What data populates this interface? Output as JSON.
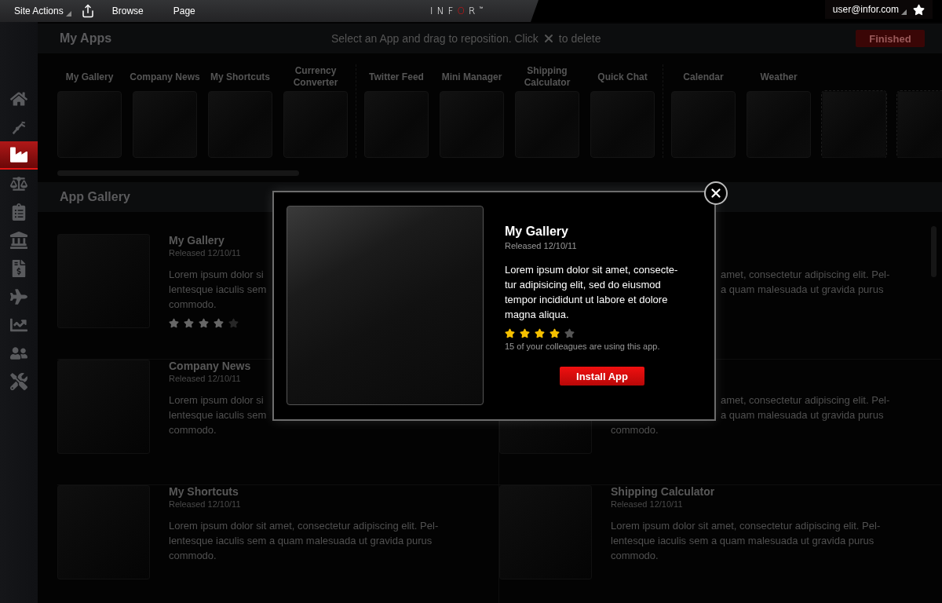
{
  "top_bar": {
    "site_actions": "Site Actions",
    "browse": "Browse",
    "page": "Page",
    "logo": [
      {
        "text": "INF",
        "accent": false
      },
      {
        "text": "O",
        "accent": true
      },
      {
        "text": "R",
        "accent": false
      }
    ],
    "logo_mark": "™",
    "user": "user@infor.com"
  },
  "sidebar": {
    "items": [
      {
        "kind": "home",
        "selected": false
      },
      {
        "kind": "robot_arm",
        "selected": false
      },
      {
        "kind": "factory",
        "selected": true
      },
      {
        "kind": "scale",
        "selected": false
      },
      {
        "kind": "clipboard",
        "selected": false
      },
      {
        "kind": "bank",
        "selected": false
      },
      {
        "kind": "invoice",
        "selected": false
      },
      {
        "kind": "plane",
        "selected": false
      },
      {
        "kind": "chart",
        "selected": false
      },
      {
        "kind": "people",
        "selected": false
      },
      {
        "kind": "tools",
        "selected": false
      }
    ]
  },
  "my_apps": {
    "title": "My Apps",
    "hint_before": "Select an App and drag to reposition. Click",
    "hint_after": "to delete",
    "finished": "Finished",
    "groups": [
      [
        {
          "kind": "app",
          "label": "My Gallery"
        },
        {
          "kind": "app",
          "label": "Company News"
        },
        {
          "kind": "app",
          "label": "My Shortcuts"
        },
        {
          "kind": "app",
          "label": "Currency Converter"
        }
      ],
      [
        {
          "kind": "app",
          "label": "Twitter Feed"
        },
        {
          "kind": "app",
          "label": "Mini Manager"
        },
        {
          "kind": "app",
          "label": "Shipping Calculator"
        },
        {
          "kind": "app",
          "label": "Quick Chat"
        }
      ],
      [
        {
          "kind": "app",
          "label": "Calendar"
        },
        {
          "kind": "app",
          "label": "Weather"
        },
        {
          "kind": "empty"
        },
        {
          "kind": "empty"
        }
      ]
    ]
  },
  "gallery": {
    "title": "App Gallery",
    "items": [
      {
        "kind": "card",
        "title": "My Gallery",
        "released": "Released 12/10/11",
        "lines": [
          {
            "text": "Lorem ipsum dolor si",
            "cut_left": false
          },
          {
            "text": "lentesque iaculis sem",
            "cut_left": false
          },
          {
            "text": "commodo.",
            "cut_left": false
          }
        ],
        "stars": 4
      },
      {
        "kind": "text_only",
        "lines": [
          {
            "text": "amet, consectetur adipiscing elit. Pel-",
            "cut_left": true
          },
          {
            "text": "a quam malesuada ut gravida purus",
            "cut_left": true
          }
        ]
      },
      {
        "kind": "card",
        "title": "Company News",
        "released": "Released 12/10/11",
        "lines": [
          {
            "text": "Lorem ipsum dolor si",
            "cut_left": false
          },
          {
            "text": "lentesque iaculis sem",
            "cut_left": false
          },
          {
            "text": "commodo.",
            "cut_left": false
          }
        ]
      },
      {
        "kind": "card",
        "lines": [
          {
            "text": "amet, consectetur adipiscing elit. Pel-",
            "cut_left": true
          },
          {
            "text": "a quam malesuada ut gravida purus",
            "cut_left": true
          },
          {
            "text": "commodo.",
            "cut_left": false
          }
        ]
      },
      {
        "kind": "card",
        "title": "My Shortcuts",
        "released": "Released 12/10/11",
        "description": [
          "Lorem ipsum dolor sit amet, consectetur adipiscing elit. Pel-",
          "lentesque iaculis sem a quam malesuada ut gravida purus",
          "commodo."
        ]
      },
      {
        "kind": "card",
        "title": "Shipping Calculator",
        "released": "Released 12/10/11",
        "description": [
          "Lorem ipsum dolor sit amet, consectetur adipiscing elit. Pel-",
          "lentesque iaculis sem a quam malesuada ut gravida purus",
          "commodo."
        ]
      }
    ]
  },
  "modal": {
    "title": "My Gallery",
    "released": "Released 12/10/11",
    "description": [
      "Lorem ipsum dolor sit amet, consecte-",
      "tur adipisicing elit, sed do eiusmod",
      "tempor incididunt ut labore et dolore",
      "magna aliqua."
    ],
    "stars": 4,
    "usage": "15 of your colleagues are using this app.",
    "install": "Install App"
  }
}
